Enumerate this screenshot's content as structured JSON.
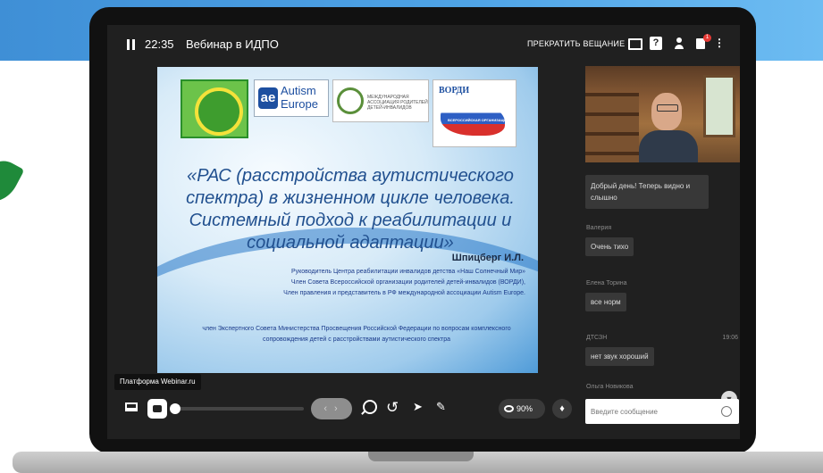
{
  "topbar": {
    "time": "22:35",
    "title": "Вебинар в ИДПО",
    "stop_label": "ПРЕКРАТИТЬ ВЕЩАНИЕ",
    "notify_count": "1"
  },
  "slide": {
    "logos": {
      "autism_mark": "ae",
      "autism_line1": "Autism",
      "autism_line2": "Europe",
      "assoc_text": "МЕЖДУНАРОДНАЯ АССОЦИАЦИЯ РОДИТЕЛЕЙ ДЕТЕЙ-ИНВАЛИДОВ",
      "vordi_label": "ВОРДИ",
      "vordi_sub": "ВСЕРОССИЙСКАЯ ОРГАНИЗАЦИЯ"
    },
    "title": "«РАС (расстройства аутистического спектра) в жизненном цикле человека. Системный подход к реабилитации и социальной адаптации»",
    "author": "Шпицберг И.Л.",
    "lines": [
      "Руководитель Центра реабилитации инвалидов детства «Наш Солнечный Мир»",
      "Член Совета Всероссийской организации родителей детей-инвалидов (ВОРДИ),",
      "Член правления и представитель в РФ международной ассоциации Autism Europe."
    ],
    "expert_line": "член Экспертного Совета Министерства Просвещения Российской Федерации по вопросам комплексного сопровождения детей с расстройствами аутистического спектра"
  },
  "chat": {
    "messages": [
      {
        "author": "",
        "time": "",
        "text": "Добрый день! Теперь видно и слышно"
      },
      {
        "author": "Валерия",
        "time": "",
        "text": "Очень тихо"
      },
      {
        "author": "Елена Торина",
        "time": "",
        "text": "все норм"
      },
      {
        "author": "ДТСЗН",
        "time": "19:06",
        "text": "нет звук хороший"
      },
      {
        "author": "Ольга Новикова",
        "time": "",
        "text": ""
      }
    ],
    "input_placeholder": "Введите сообщение"
  },
  "controls": {
    "platform_tip": "Платформа Webinar.ru",
    "views_label": "90%"
  },
  "icons": [
    "pause-icon",
    "chat-icon",
    "document-icon",
    "user-icon",
    "notification-icon",
    "more-icon",
    "screen-share-icon",
    "camera-icon",
    "zoom-icon",
    "undo-icon",
    "pointer-icon",
    "pen-icon",
    "eye-icon",
    "fire-icon",
    "emoji-icon",
    "chevron-down-icon"
  ],
  "colors": {
    "accent_blue": "#4ea3e6",
    "screen_bg": "#202020",
    "slide_title": "#21508f",
    "badge_red": "#e53935"
  }
}
